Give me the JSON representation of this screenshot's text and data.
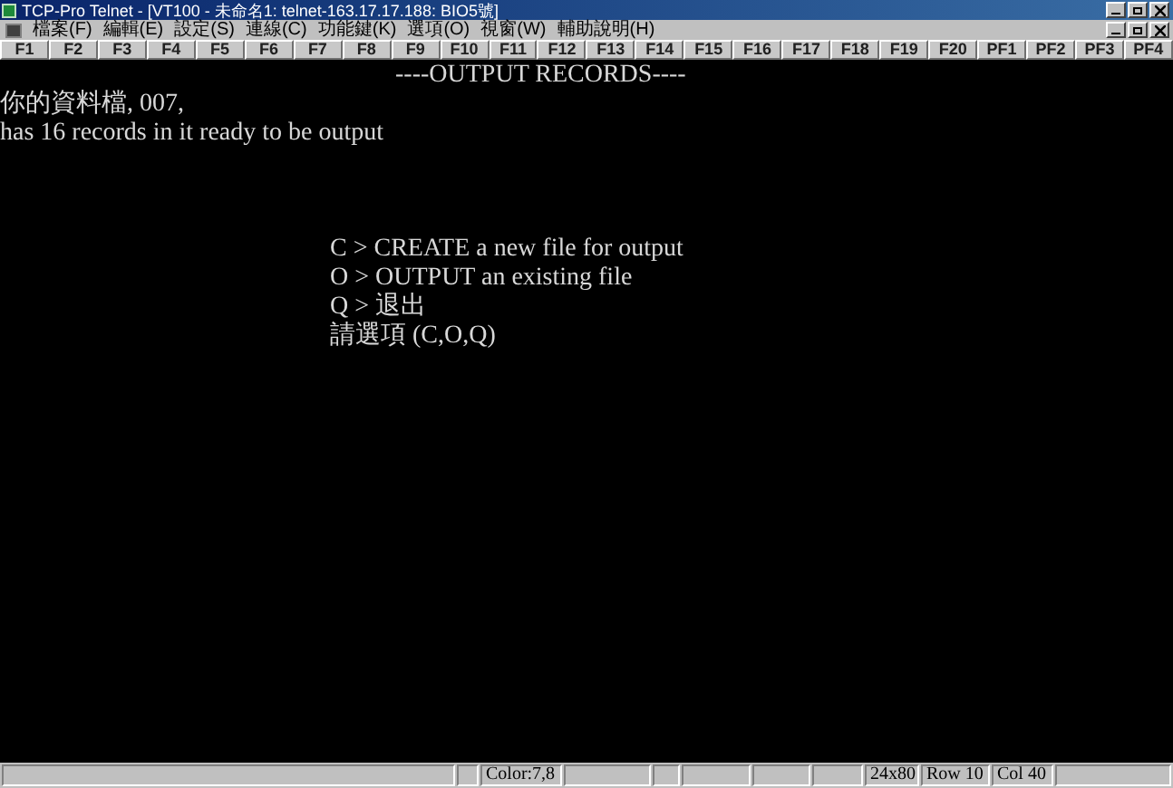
{
  "window": {
    "title": "TCP-Pro Telnet - [VT100 - 未命名1: telnet-163.17.17.188: BIO5號]"
  },
  "menu": [
    "檔案(F)",
    "編輯(E)",
    "設定(S)",
    "連線(C)",
    "功能鍵(K)",
    "選項(O)",
    "視窗(W)",
    "輔助說明(H)"
  ],
  "function_keys": [
    "F1",
    "F2",
    "F3",
    "F4",
    "F5",
    "F6",
    "F7",
    "F8",
    "F9",
    "F10",
    "F11",
    "F12",
    "F13",
    "F14",
    "F15",
    "F16",
    "F17",
    "F18",
    "F19",
    "F20",
    "PF1",
    "PF2",
    "PF3",
    "PF4"
  ],
  "terminal": {
    "lines": [
      {
        "kind": "heading",
        "text": "----OUTPUT RECORDS----"
      },
      {
        "kind": "body",
        "text": "你的資料檔, 007,"
      },
      {
        "kind": "body",
        "text": "has 16 records in it ready to be output"
      },
      {
        "kind": "menu",
        "text": "C > CREATE a new file for output"
      },
      {
        "kind": "menu",
        "text": "O > OUTPUT an existing file"
      },
      {
        "kind": "menu",
        "text": "Q > 退出"
      },
      {
        "kind": "menu",
        "text": "請選項 (C,O,Q)"
      }
    ]
  },
  "status_bar": {
    "color_setting": "Color:7,8",
    "size": "24x80",
    "row": "Row 10",
    "col": "Col 40"
  }
}
